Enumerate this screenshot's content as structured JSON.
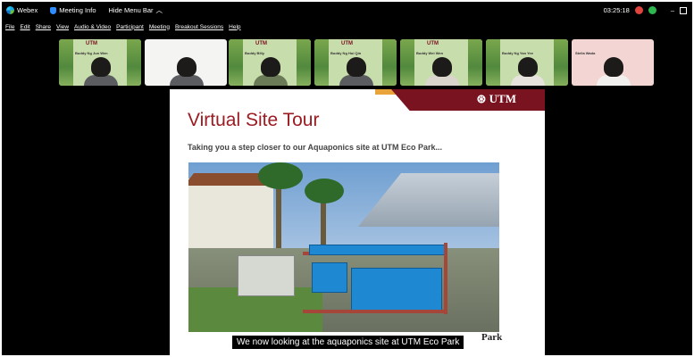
{
  "titlebar": {
    "app_name": "Webex",
    "meeting_info": "Meeting Info",
    "hide_menu_bar": "Hide Menu Bar",
    "time": "03:25:18",
    "minimize": "–"
  },
  "menu": [
    "File",
    "Edit",
    "Share",
    "View",
    "Audio & Video",
    "Participant",
    "Meeting",
    "Breakout Sessions",
    "Help"
  ],
  "participants": [
    {
      "logo": "UTM",
      "caption": "Buddy Ng Jun Wen",
      "bg": "green"
    },
    {
      "logo": "",
      "caption": "",
      "bg": "white"
    },
    {
      "logo": "UTM",
      "caption": "Buddy Billy",
      "bg": "green"
    },
    {
      "logo": "UTM",
      "caption": "Buddy Ng Hui Qin",
      "bg": "green"
    },
    {
      "logo": "UTM",
      "caption": "Buddy Wei Wen",
      "bg": "green"
    },
    {
      "logo": "",
      "caption": "Buddy Ng Yan Yee",
      "bg": "green"
    },
    {
      "logo": "",
      "caption": "Stella Wada",
      "bg": "pink"
    }
  ],
  "slide": {
    "logo": "UTM",
    "title": "Virtual Site Tour",
    "subtitle": "Taking you a step closer to our Aquaponics site at UTM Eco Park...",
    "photo_footer": "Park"
  },
  "caption": "We now looking at the aquaponics site at UTM Eco Park",
  "colors": {
    "background": "#000000",
    "slide_title": "#9b1c22",
    "maroon": "#7a1320",
    "gold": "#e8a33a"
  }
}
